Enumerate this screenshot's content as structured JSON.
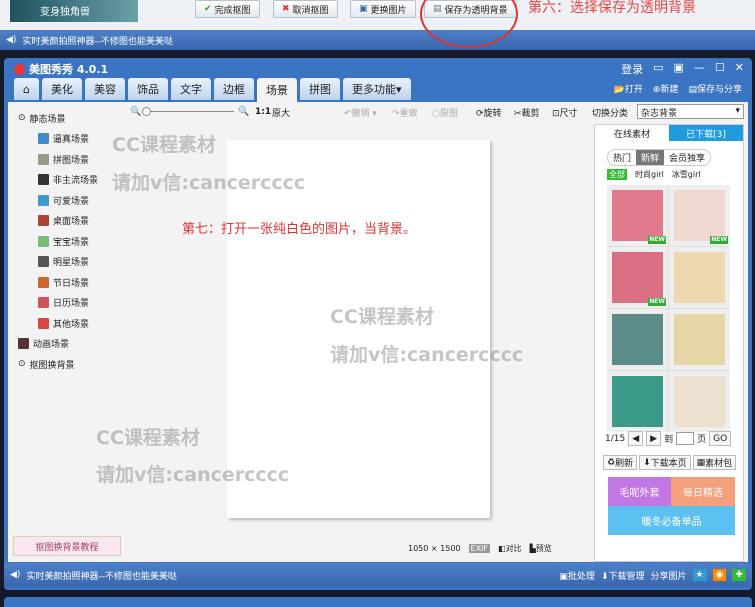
{
  "prev_window": {
    "promo": "变身独角兽",
    "buttons": [
      "完成抠图",
      "取消抠图",
      "更换图片",
      "保存为透明背景"
    ],
    "annotation": "第六：选择保存为透明背景",
    "status": "实时美颜拍照神器--不修图也能美美哒"
  },
  "window": {
    "title": "美图秀秀 4.0.1",
    "login": "登录"
  },
  "tabs": [
    "美化",
    "美容",
    "饰品",
    "文字",
    "边框",
    "场景",
    "拼图",
    "更多功能"
  ],
  "actions": [
    "打开",
    "新建",
    "保存与分享"
  ],
  "toolbar": {
    "zoom": "1:1",
    "original_size": "原大",
    "undo": "撤销",
    "redo": "重做",
    "original": "原图",
    "rotate": "旋转",
    "crop": "裁剪",
    "size": "尺寸",
    "category_label": "切换分类",
    "category_value": "杂志背景"
  },
  "sidebar": {
    "group": "静态场景",
    "items": [
      "逼真场景",
      "拼图场景",
      "非主流场景",
      "可爱场景",
      "桌面场景",
      "宝宝场景",
      "明星场景",
      "节日场景",
      "日历场景",
      "其他场景"
    ],
    "animated": "动画场景",
    "cutout": "抠图换背景",
    "tutorial": "抠图换背景教程"
  },
  "canvas": {
    "annotation": "第七：打开一张纯白色的图片，当背景。",
    "dimensions": "1050 × 1500",
    "exif": "EXIF",
    "compare": "对比",
    "preview": "预览"
  },
  "watermark": {
    "line1": "CC课程素材",
    "line2": "请加v信:cancercccc"
  },
  "panel": {
    "tabs": [
      "在线素材",
      "已下载[3]"
    ],
    "filters": [
      "热门",
      "新鲜",
      "会员独享"
    ],
    "subfilters": [
      "全部",
      "时尚girl",
      "冰雪girl"
    ],
    "new_badge": "NEW",
    "page": "1/15",
    "goto": "到",
    "page_unit": "页",
    "go": "GO",
    "buttons": [
      "刷新",
      "下载本页",
      "素材包"
    ],
    "banners": [
      "毛呢外套",
      "每日精选",
      "暖冬必备单品"
    ]
  },
  "statusbar": {
    "text": "实时美颜拍照神器--不修图也能美美哒",
    "batch": "批处理",
    "download": "下载管理",
    "share": "分享图片"
  }
}
